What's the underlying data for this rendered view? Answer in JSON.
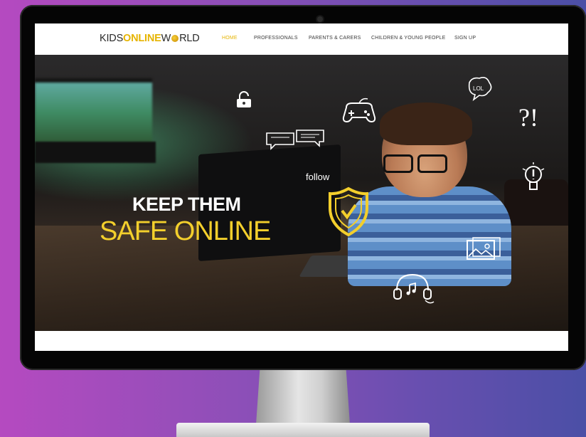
{
  "nav": {
    "logo": {
      "part1": "KIDS",
      "part2": "ONLINE",
      "part3": "W",
      "part4": "RLD"
    },
    "items": [
      {
        "label": "HOME",
        "active": true
      },
      {
        "label": "PROFESSIONALS",
        "active": false
      },
      {
        "label": "PARENTS & CARERS",
        "active": false
      },
      {
        "label": "CHILDREN & YOUNG PEOPLE",
        "active": false
      },
      {
        "label": "SIGN UP",
        "active": false
      }
    ]
  },
  "hero": {
    "title": "KEEP THEM",
    "subtitle": "SAFE ONLINE",
    "doodle_text": "follow",
    "doodle_lol": "LOL",
    "doodle_qe": "?!"
  },
  "colors": {
    "accent": "#e6b400",
    "hero_subtitle": "#f3cf2c",
    "background_left": "#b54ac0",
    "background_right": "#4b4fa6"
  },
  "icons": [
    "lock-icon",
    "chat-bubbles-icon",
    "gamepad-icon",
    "lol-bubble-icon",
    "shield-check-icon",
    "question-exclamation-icon",
    "lightbulb-icon",
    "photos-icon",
    "headphones-music-icon"
  ]
}
